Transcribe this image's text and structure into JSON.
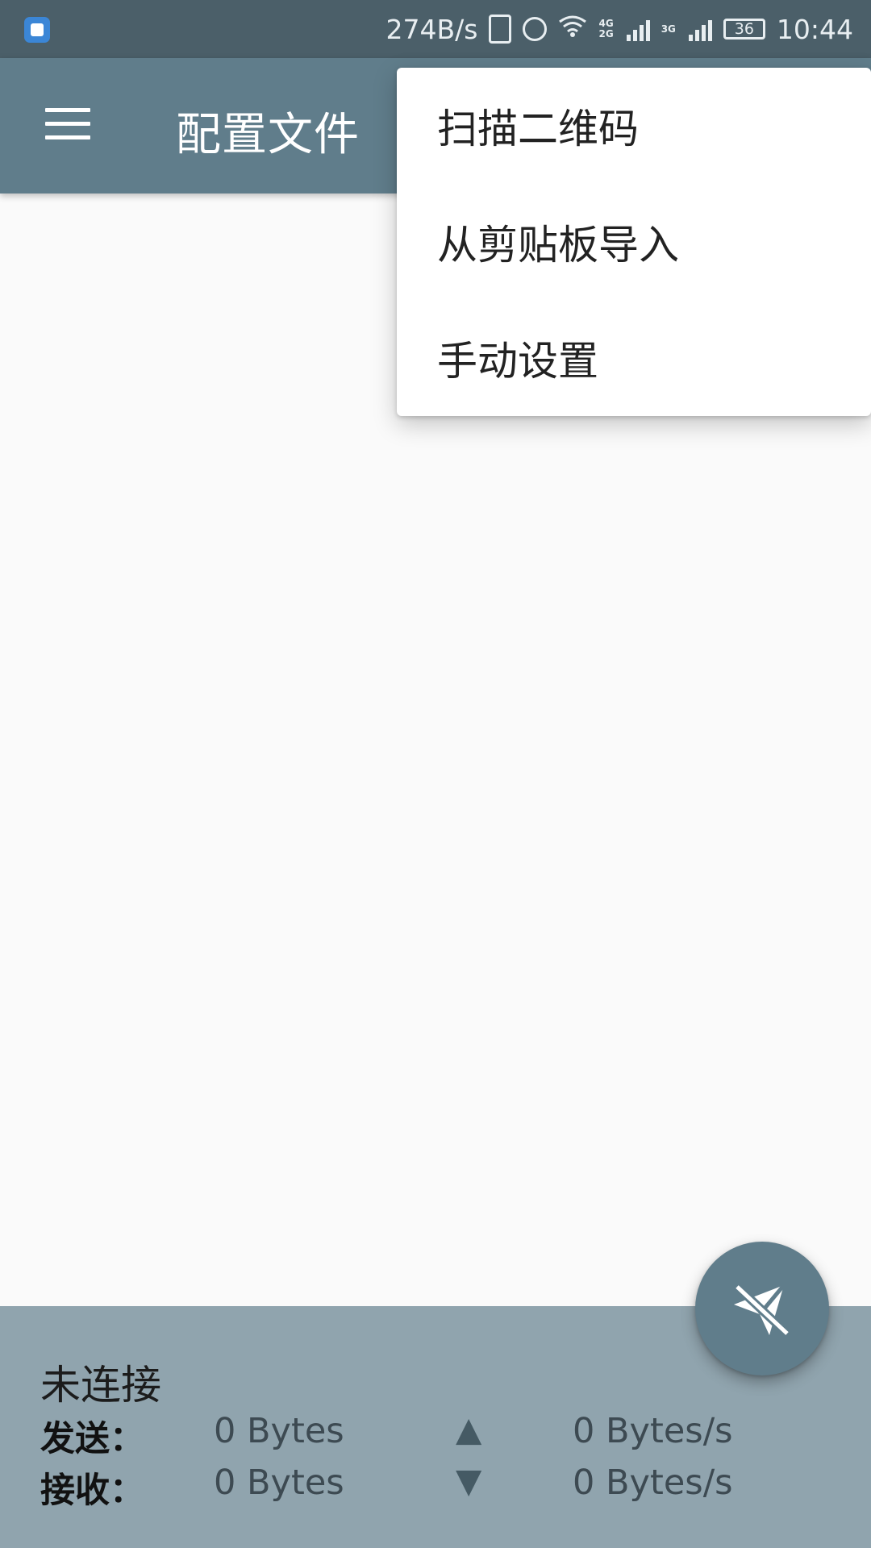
{
  "status_bar": {
    "net_speed": "274B/s",
    "net_type_top": "4G",
    "net_type_bottom": "2G",
    "net_type_2": "3G",
    "battery": "36",
    "time": "10:44",
    "icons": [
      "app-notification-icon",
      "vibrate-icon",
      "alarm-icon",
      "wifi-icon",
      "signal-icon",
      "battery-icon"
    ]
  },
  "toolbar": {
    "title": "配置文件",
    "menu_icon": "hamburger-menu-icon"
  },
  "popup_menu": {
    "items": [
      {
        "label": "扫描二维码"
      },
      {
        "label": "从剪贴板导入"
      },
      {
        "label": "手动设置"
      }
    ]
  },
  "stats": {
    "status": "未连接",
    "sent_label": "发送：",
    "received_label": "接收：",
    "sent_total": "0 Bytes",
    "received_total": "0 Bytes",
    "sent_rate": "0 Bytes/s",
    "received_rate": "0 Bytes/s",
    "up_arrow": "▲",
    "down_arrow": "▼"
  },
  "fab": {
    "icon": "paper-plane-off-icon",
    "color": "#607d8b"
  },
  "colors": {
    "status_bar": "#4b5f69",
    "toolbar": "#607d8b",
    "stats_panel": "#90a4ae",
    "background": "#fafafa"
  }
}
